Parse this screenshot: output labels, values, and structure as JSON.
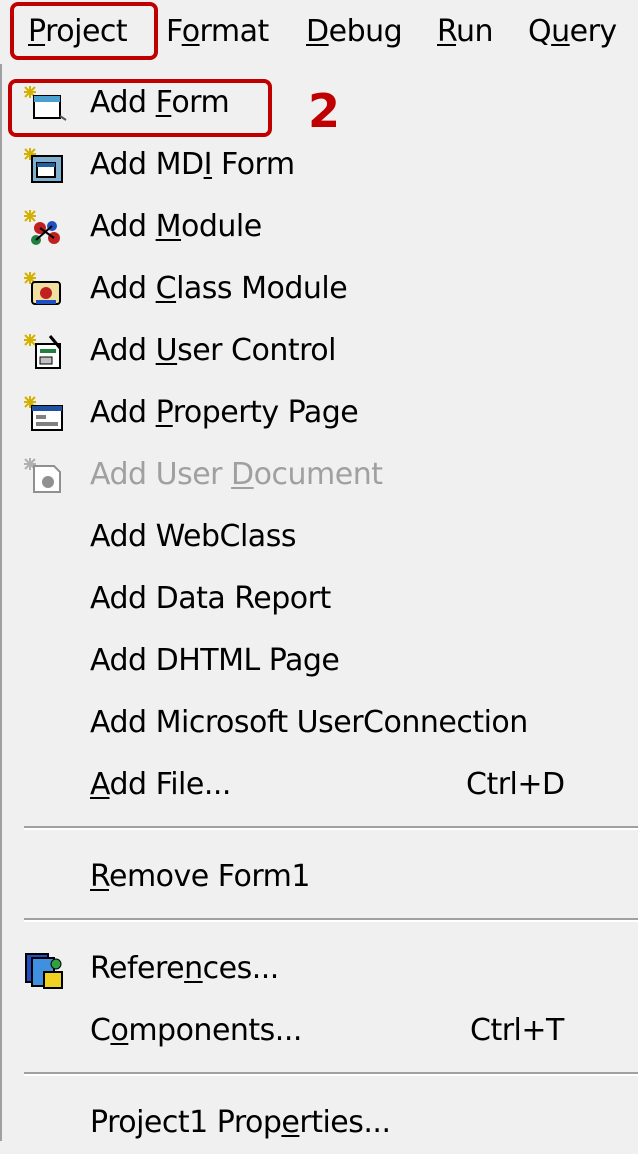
{
  "menubar": {
    "items": [
      {
        "pre": "",
        "key": "P",
        "post": "roject"
      },
      {
        "pre": "F",
        "key": "o",
        "post": "rmat"
      },
      {
        "pre": "",
        "key": "D",
        "post": "ebug"
      },
      {
        "pre": "",
        "key": "R",
        "post": "un"
      },
      {
        "pre": "Q",
        "key": "u",
        "post": "ery"
      }
    ]
  },
  "menu": {
    "items": [
      {
        "pre": "Add ",
        "key": "F",
        "post": "orm",
        "icon": "add-form-icon"
      },
      {
        "pre": "Add MD",
        "key": "I",
        "post": " Form",
        "icon": "add-mdi-form-icon"
      },
      {
        "pre": "Add ",
        "key": "M",
        "post": "odule",
        "icon": "add-module-icon"
      },
      {
        "pre": "Add ",
        "key": "C",
        "post": "lass Module",
        "icon": "add-class-module-icon"
      },
      {
        "pre": "Add ",
        "key": "U",
        "post": "ser Control",
        "icon": "add-user-control-icon"
      },
      {
        "pre": "Add ",
        "key": "P",
        "post": "roperty Page",
        "icon": "add-property-page-icon"
      },
      {
        "pre": "Add User ",
        "key": "D",
        "post": "ocument",
        "icon": "add-user-document-icon",
        "disabled": true
      },
      {
        "label": "Add WebClass"
      },
      {
        "label": "Add Data Report"
      },
      {
        "label": "Add DHTML Page"
      },
      {
        "label": "Add Microsoft UserConnection"
      },
      {
        "pre": "",
        "key": "A",
        "post": "dd File...",
        "shortcut": "Ctrl+D"
      },
      {
        "pre": "",
        "key": "R",
        "post": "emove Form1"
      },
      {
        "pre": "Refere",
        "key": "n",
        "post": "ces...",
        "icon": "references-icon"
      },
      {
        "pre": "C",
        "key": "o",
        "post": "mponents...",
        "shortcut": "Ctrl+T"
      },
      {
        "pre": "Project1 Prop",
        "key": "e",
        "post": "rties..."
      }
    ]
  },
  "annotation": {
    "step_number": "2",
    "color": "#c00000"
  },
  "colors": {
    "menu_bg": "#f0f0f0",
    "disabled_text": "#a0a0a0",
    "highlight": "#c00000"
  }
}
